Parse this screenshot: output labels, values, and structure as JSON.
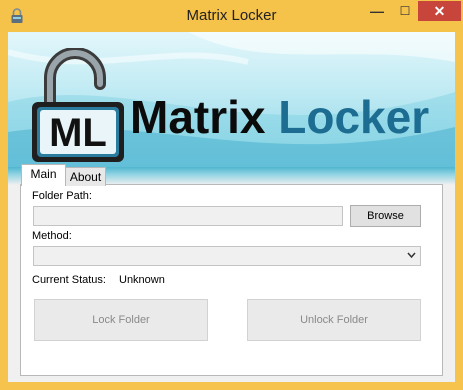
{
  "window": {
    "title": "Matrix Locker"
  },
  "controls": {
    "minimize": "—",
    "maximize": "☐",
    "close": "✕"
  },
  "banner": {
    "logo_letters": "ML",
    "brand_word1": "Matrix",
    "brand_word2": "Locker"
  },
  "tabs": [
    {
      "label": "Main",
      "selected": true
    },
    {
      "label": "About",
      "selected": false
    }
  ],
  "main": {
    "folder_path_label": "Folder Path:",
    "folder_path_value": "",
    "browse_label": "Browse",
    "method_label": "Method:",
    "method_value": "",
    "status_label": "Current Status:",
    "status_value": "Unknown",
    "lock_label": "Lock Folder",
    "unlock_label": "Unlock Folder"
  },
  "colors": {
    "frame": "#f6c44c",
    "close": "#c7453b",
    "brand_blue": "#1d6d92"
  }
}
